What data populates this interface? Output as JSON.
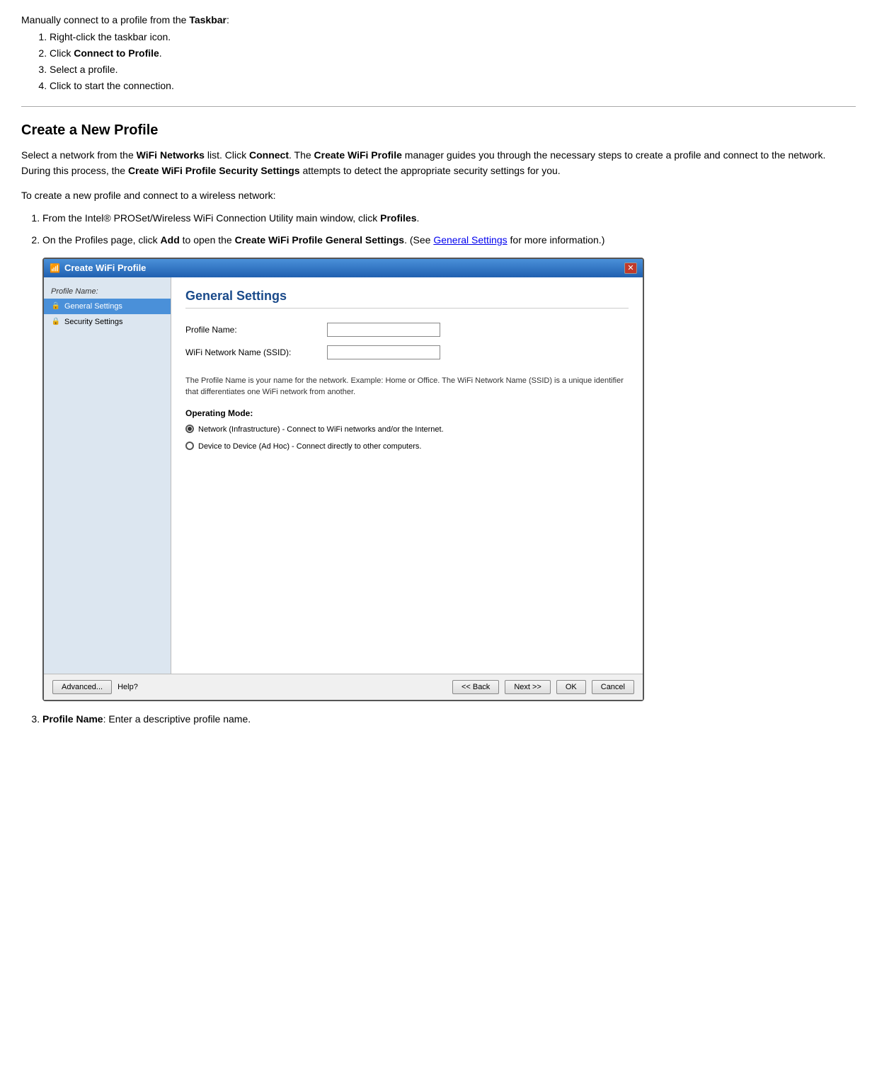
{
  "intro": {
    "text": "Manually connect to a profile from the ",
    "bold": "Taskbar",
    "colon": ":"
  },
  "taskbar_steps": [
    {
      "text": "Right-click the taskbar icon."
    },
    {
      "text_before": "Click ",
      "bold": "Connect to Profile",
      "text_after": "."
    },
    {
      "text": "Select a profile."
    },
    {
      "text": "Click to start the connection."
    }
  ],
  "section_title": "Create a New Profile",
  "section_desc_1": "Select a network from the ",
  "section_desc_2": "WiFi Networks",
  "section_desc_3": " list. Click ",
  "section_desc_4": "Connect",
  "section_desc_5": ". The ",
  "section_desc_6": "Create WiFi Profile",
  "section_desc_7": " manager guides you through the necessary steps to create a profile and connect to the network. During this process, the ",
  "section_desc_8": "Create WiFi Profile Security Settings",
  "section_desc_9": " attempts to detect the appropriate security settings for you.",
  "to_create_text": "To create a new profile and connect to a wireless network:",
  "steps": [
    {
      "text_before": "From the Intel® PROSet/Wireless WiFi Connection Utility main window, click ",
      "bold": "Profiles",
      "text_after": "."
    },
    {
      "text_before": "On the Profiles page, click ",
      "bold1": "Add",
      "text_mid": " to open the ",
      "bold2": "Create WiFi Profile General Settings",
      "text_after": ". (See ",
      "link": "General Settings",
      "text_end": " for more information.)"
    }
  ],
  "dialog": {
    "title": "Create WiFi Profile",
    "close_icon": "✕",
    "sidebar": {
      "profile_name_label": "Profile Name:",
      "items": [
        {
          "label": "General Settings",
          "active": true
        },
        {
          "label": "Security Settings",
          "active": false
        }
      ]
    },
    "main": {
      "title": "General Settings",
      "form_fields": [
        {
          "label": "Profile Name:",
          "input": true
        },
        {
          "label": "WiFi Network Name (SSID):",
          "input": true
        }
      ],
      "desc": "The Profile Name is your name for the network. Example: Home or Office. The WiFi Network Name (SSID) is a unique identifier that differentiates one WiFi network from another.",
      "operating_mode_label": "Operating Mode:",
      "radio_options": [
        {
          "selected": true,
          "label": "Network (Infrastructure) - Connect to WiFi networks and/or the Internet."
        },
        {
          "selected": false,
          "label": "Device to Device (Ad Hoc) - Connect directly to other computers."
        }
      ]
    },
    "footer": {
      "advanced_btn": "Advanced...",
      "help_text": "Help?",
      "back_btn": "<< Back",
      "next_btn": "Next >>",
      "ok_btn": "OK",
      "cancel_btn": "Cancel"
    }
  },
  "step3": {
    "bold": "Profile Name",
    "text": ": Enter a descriptive profile name."
  }
}
